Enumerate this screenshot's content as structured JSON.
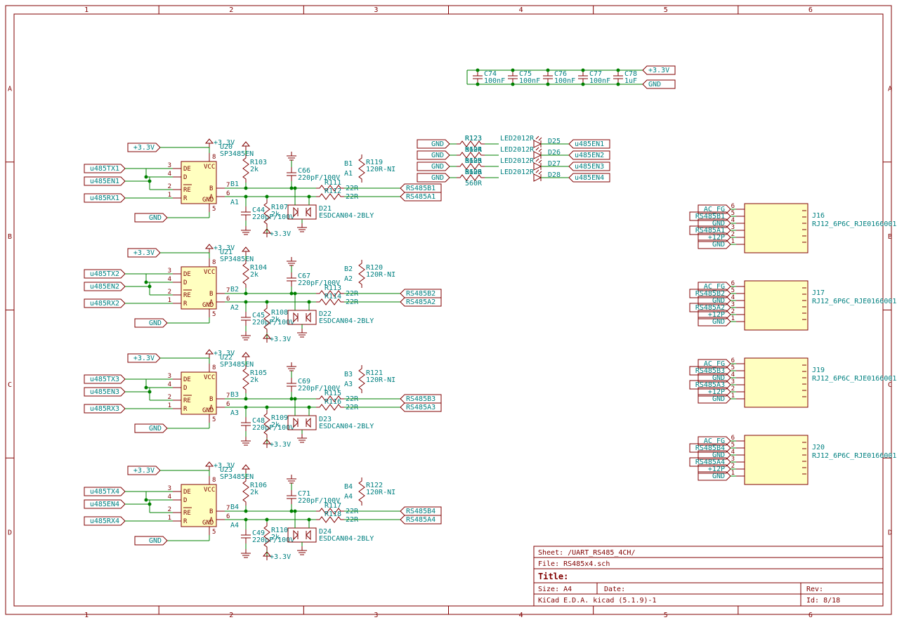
{
  "frame": {
    "cols": [
      "1",
      "2",
      "3",
      "4",
      "5",
      "6"
    ],
    "rows": [
      "A",
      "B",
      "C",
      "D"
    ]
  },
  "titleblock": {
    "sheet": "Sheet: /UART_RS485_4CH/",
    "file": "File: RS485x4.sch",
    "title_label": "Title:",
    "size_label": "Size: A4",
    "date_label": "Date:",
    "rev_label": "Rev:",
    "gen": "KiCad E.D.A.  kicad (5.1.9)-1",
    "id": "Id: 8/18"
  },
  "power": {
    "v33": "+3.3V",
    "gnd": "GND",
    "v12p": "+12P"
  },
  "caps_top": [
    {
      "ref": "C74",
      "val": "100nF"
    },
    {
      "ref": "C75",
      "val": "100nF"
    },
    {
      "ref": "C76",
      "val": "100nF"
    },
    {
      "ref": "C77",
      "val": "100nF"
    },
    {
      "ref": "C78",
      "val": "1uF"
    }
  ],
  "leds": [
    {
      "r_ref": "R123",
      "r_val": "560R",
      "d_ref": "D25",
      "d_val": "LED2012R",
      "net": "u485EN1"
    },
    {
      "r_ref": "R124",
      "r_val": "560R",
      "d_ref": "D26",
      "d_val": "LED2012R",
      "net": "u485EN2"
    },
    {
      "r_ref": "R125",
      "r_val": "560R",
      "d_ref": "D27",
      "d_val": "LED2012R",
      "net": "u485EN3"
    },
    {
      "r_ref": "R126",
      "r_val": "560R",
      "d_ref": "D28",
      "d_val": "LED2012R",
      "net": "u485EN4"
    }
  ],
  "channels": [
    {
      "ic_ref": "U20",
      "ic_val": "SP3485EN",
      "tx": "u485TX1",
      "en": "u485EN1",
      "rx": "u485RX1",
      "rbias": {
        "ref": "R103",
        "val": "2k"
      },
      "c_top": {
        "ref": "C66",
        "val": "220pF/100V"
      },
      "c_bot": {
        "ref": "C44",
        "val": "220pF/100V"
      },
      "rbias2": {
        "ref": "R107",
        "val": "2k"
      },
      "rser": [
        {
          "ref": "R111",
          "val": "22R"
        },
        {
          "ref": "R112",
          "val": "22R"
        }
      ],
      "rterm": {
        "ref": "R119",
        "val": "120R-NI"
      },
      "esd": {
        "ref": "D21",
        "val": "ESDCAN04-2BLY"
      },
      "netB": "RS485B1",
      "netA": "RS485A1",
      "nB": "B1",
      "nA": "A1"
    },
    {
      "ic_ref": "U21",
      "ic_val": "SP3485EN",
      "tx": "u485TX2",
      "en": "u485EN2",
      "rx": "u485RX2",
      "rbias": {
        "ref": "R104",
        "val": "2k"
      },
      "c_top": {
        "ref": "C67",
        "val": "220pF/100V"
      },
      "c_bot": {
        "ref": "C45",
        "val": "220pF/100V"
      },
      "rbias2": {
        "ref": "R108",
        "val": "2k"
      },
      "rser": [
        {
          "ref": "R113",
          "val": "22R"
        },
        {
          "ref": "R114",
          "val": "22R"
        }
      ],
      "rterm": {
        "ref": "R120",
        "val": "120R-NI"
      },
      "esd": {
        "ref": "D22",
        "val": "ESDCAN04-2BLY"
      },
      "netB": "RS485B2",
      "netA": "RS485A2",
      "nB": "B2",
      "nA": "A2"
    },
    {
      "ic_ref": "U22",
      "ic_val": "SP3485EN",
      "tx": "u485TX3",
      "en": "u485EN3",
      "rx": "u485RX3",
      "rbias": {
        "ref": "R105",
        "val": "2k"
      },
      "c_top": {
        "ref": "C69",
        "val": "220pF/100V"
      },
      "c_bot": {
        "ref": "C48",
        "val": "220pF/100V"
      },
      "rbias2": {
        "ref": "R109",
        "val": "2k"
      },
      "rser": [
        {
          "ref": "R115",
          "val": "22R"
        },
        {
          "ref": "R116",
          "val": "22R"
        }
      ],
      "rterm": {
        "ref": "R121",
        "val": "120R-NI"
      },
      "esd": {
        "ref": "D23",
        "val": "ESDCAN04-2BLY"
      },
      "netB": "RS485B3",
      "netA": "RS485A3",
      "nB": "B3",
      "nA": "A3"
    },
    {
      "ic_ref": "U23",
      "ic_val": "SP3485EN",
      "tx": "u485TX4",
      "en": "u485EN4",
      "rx": "u485RX4",
      "rbias": {
        "ref": "R106",
        "val": "2k"
      },
      "c_top": {
        "ref": "C71",
        "val": "220pF/100V"
      },
      "c_bot": {
        "ref": "C49",
        "val": "220pF/100V"
      },
      "rbias2": {
        "ref": "R110",
        "val": "2k"
      },
      "rser": [
        {
          "ref": "R117",
          "val": "22R"
        },
        {
          "ref": "R118",
          "val": "22R"
        }
      ],
      "rterm": {
        "ref": "R122",
        "val": "120R-NI"
      },
      "esd": {
        "ref": "D24",
        "val": "ESDCAN04-2BLY"
      },
      "netB": "RS485B4",
      "netA": "RS485A4",
      "nB": "B4",
      "nA": "A4"
    }
  ],
  "connectors": [
    {
      "ref": "J16",
      "val": "RJ12_6P6C_RJE0166001",
      "pins": [
        "AC_FG",
        "RS485B1",
        "GND",
        "RS485A1",
        "+12P",
        "GND"
      ]
    },
    {
      "ref": "J17",
      "val": "RJ12_6P6C_RJE0166001",
      "pins": [
        "AC_FG",
        "RS485B2",
        "GND",
        "RS485A2",
        "+12P",
        "GND"
      ]
    },
    {
      "ref": "J19",
      "val": "RJ12_6P6C_RJE0166001",
      "pins": [
        "AC_FG",
        "RS485B3",
        "GND",
        "RS485A3",
        "+12P",
        "GND"
      ]
    },
    {
      "ref": "J20",
      "val": "RJ12_6P6C_RJE0166001",
      "pins": [
        "AC_FG",
        "RS485B4",
        "GND",
        "RS485A4",
        "+12P",
        "GND"
      ]
    }
  ],
  "ic_pins": {
    "DE": "3",
    "D": "4",
    "RE": "2",
    "R": "1",
    "VCC": "8",
    "GND": "5",
    "B": "7",
    "A": "6"
  }
}
